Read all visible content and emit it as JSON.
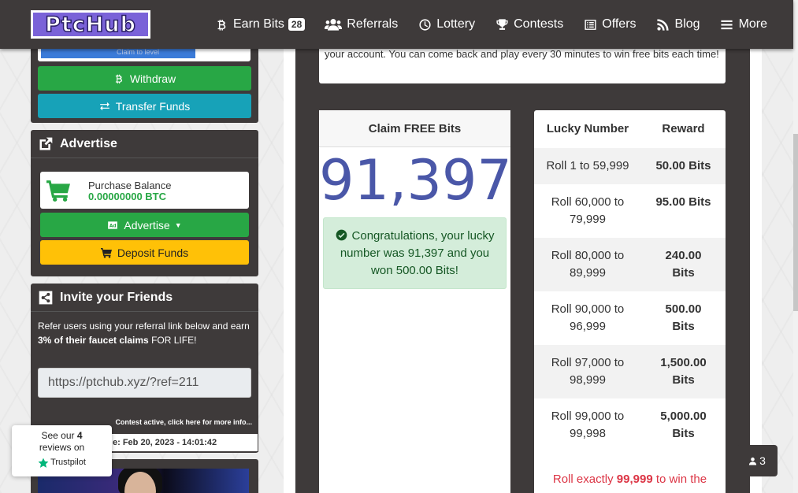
{
  "nav": {
    "logo": "PtcHub",
    "items": [
      {
        "label": "Earn Bits",
        "badge": "28",
        "icon": "bitcoin-icon"
      },
      {
        "label": "Referrals",
        "icon": "users-icon"
      },
      {
        "label": "Lottery",
        "icon": "clock-icon"
      },
      {
        "label": "Contests",
        "icon": "trophy-icon"
      },
      {
        "label": "Offers",
        "icon": "list-icon"
      },
      {
        "label": "Blog",
        "icon": "rss-icon"
      },
      {
        "label": "More",
        "icon": "bars-icon"
      }
    ]
  },
  "sidebar": {
    "xp_label": "Claim to level",
    "withdraw": "Withdraw",
    "transfer": "Transfer Funds",
    "advertise_title": "Advertise",
    "purchase_label": "Purchase Balance",
    "purchase_value": "0.00000000 BTC",
    "advertise_btn": "Advertise",
    "deposit_btn": "Deposit Funds",
    "invite_title": "Invite your Friends",
    "invite_text_1": "Refer users using your referral link below and earn",
    "invite_text_bold": "3% of their faucet claims",
    "invite_text_2": "FOR LIFE!",
    "ref_link": "https://ptchub.xyz/?ref=211",
    "contest_line": "Contest active, click here for more info...",
    "date_line": "e: Feb 20, 2023 - 14:01:42"
  },
  "trustpilot": {
    "line1_pre": "See our",
    "line1_num": "4",
    "line2": "reviews on",
    "brand": "Trustpilot"
  },
  "main": {
    "info_text": "your account. You can come back and play every 30 minutes to win free bits each time!",
    "claim_title": "Claim FREE Bits",
    "lucky_number": "91,397",
    "success_msg": "Congratulations, your lucky number was 91,397 and you won 500.00 Bits!",
    "table_headers": [
      "Lucky Number",
      "Reward"
    ],
    "rows": [
      {
        "range": "Roll 1 to 59,999",
        "reward": "50.00 Bits"
      },
      {
        "range": "Roll 60,000 to 79,999",
        "reward": "95.00 Bits"
      },
      {
        "range": "Roll 80,000 to 89,999",
        "reward": "240.00 Bits"
      },
      {
        "range": "Roll 90,000 to 96,999",
        "reward": "500.00 Bits"
      },
      {
        "range": "Roll 97,000 to 98,999",
        "reward": "1,500.00 Bits"
      },
      {
        "range": "Roll 99,000 to 99,998",
        "reward": "5,000.00 Bits"
      }
    ],
    "foot_pre": "Roll exactly",
    "foot_num": "99,999",
    "foot_post": "to win the"
  },
  "online": {
    "count": "3"
  },
  "colors": {
    "dark": "#3e3a3a",
    "green": "#28a745",
    "teal": "#17a2b8",
    "yellow": "#ffc107",
    "accent": "#4a57a8"
  }
}
